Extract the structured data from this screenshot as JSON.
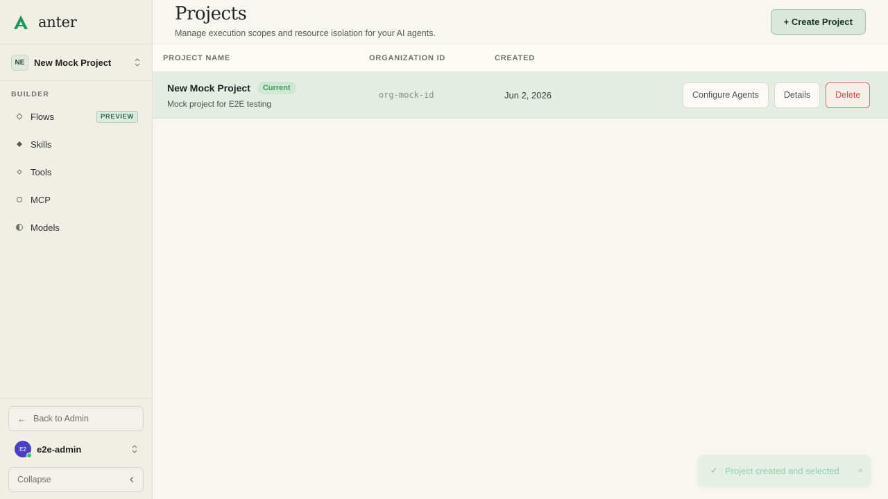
{
  "brand": {
    "name": "anter",
    "accent": "#1a9a5a"
  },
  "project_switcher": {
    "badge": "NE",
    "name": "New Mock Project"
  },
  "sidebar": {
    "section_label": "BUILDER",
    "items": [
      {
        "label": "Flows",
        "icon": "diamond-outline-icon",
        "badge": "PREVIEW"
      },
      {
        "label": "Skills",
        "icon": "diamond-filled-icon"
      },
      {
        "label": "Tools",
        "icon": "diamond-small-icon"
      },
      {
        "label": "MCP",
        "icon": "circle-outline-icon"
      },
      {
        "label": "Models",
        "icon": "half-circle-icon"
      }
    ],
    "back_label": "Back to Admin",
    "user": {
      "initials": "E2",
      "name": "e2e-admin"
    },
    "collapse_label": "Collapse"
  },
  "header": {
    "title": "Projects",
    "subtitle": "Manage execution scopes and resource isolation for your AI agents.",
    "create_label": "+ Create Project"
  },
  "table": {
    "columns": [
      "PROJECT NAME",
      "ORGANIZATION ID",
      "CREATED"
    ],
    "rows": [
      {
        "name": "New Mock Project",
        "badge": "Current",
        "description": "Mock project for E2E testing",
        "org_id": "org-mock-id",
        "created": "Jun 2, 2026",
        "actions": [
          "Configure Agents",
          "Details",
          "Delete"
        ]
      }
    ]
  },
  "toast": {
    "message": "Project created and selected",
    "close": "×"
  }
}
